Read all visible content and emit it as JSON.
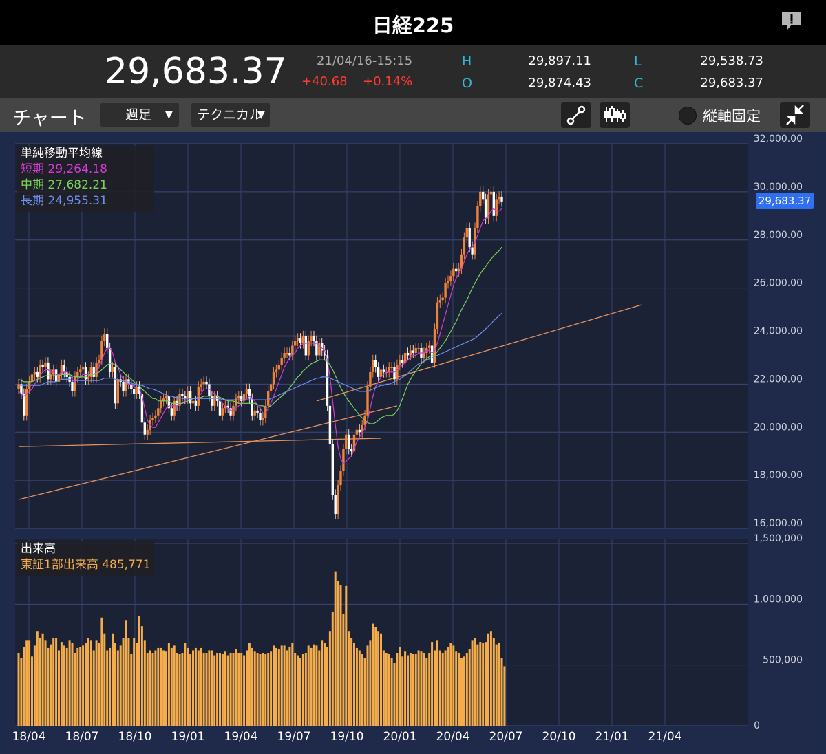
{
  "app": {
    "title": "日経225"
  },
  "quote": {
    "price": "29,683.37",
    "timestamp": "21/04/16-15:15",
    "change": "+40.68",
    "change_pct": "+0.14%",
    "h_label": "H",
    "h_value": "29,897.11",
    "o_label": "O",
    "o_value": "29,874.43",
    "l_label": "L",
    "l_value": "29,538.73",
    "c_label": "C",
    "c_value": "29,683.37"
  },
  "toolbar": {
    "title": "チャート",
    "period": "週足",
    "technical": "テクニカル",
    "lock_label": "縦軸固定"
  },
  "colors": {
    "up": "#f0823a",
    "down": "#ffffff",
    "short_ma": "#d23cd2",
    "mid_ma": "#7bd45a",
    "long_ma": "#6f8ff0",
    "volume": "#f4ad4a",
    "accent": "#2f6ff0"
  },
  "icons": [
    "alert-icon",
    "trendline-icon",
    "candle-tool-icon",
    "collapse-icon"
  ],
  "ma_legend": {
    "title": "単純移動平均線",
    "short_label": "短期",
    "short_value": "29,264.18",
    "mid_label": "中期",
    "mid_value": "27,682.21",
    "long_label": "長期",
    "long_value": "24,955.31"
  },
  "vol_legend": {
    "title": "出来高",
    "label": "東証1部出来高",
    "value": "485,771"
  },
  "price_tag": "29,683.37",
  "chart_data": {
    "type": "candlestick",
    "x_tick_labels": [
      "18/04",
      "18/07",
      "18/10",
      "19/01",
      "19/04",
      "19/07",
      "19/10",
      "20/01",
      "20/04",
      "20/07",
      "20/10",
      "21/01",
      "21/04"
    ],
    "y_tick_labels": [
      "16,000.00",
      "18,000.00",
      "20,000.00",
      "22,000.00",
      "24,000.00",
      "26,000.00",
      "28,000.00",
      "30,000.00",
      "32,000.00"
    ],
    "ylim": [
      16000,
      32000
    ],
    "vol_tick_labels": [
      "0",
      "500,000",
      "1,000,000",
      "1,500,000"
    ],
    "vol_ylim": [
      0,
      1500000
    ],
    "closes": [
      22000,
      21600,
      20700,
      21800,
      22100,
      22400,
      22500,
      22300,
      22800,
      22700,
      22900,
      22200,
      22400,
      22600,
      22100,
      22400,
      22800,
      22500,
      22300,
      22100,
      21700,
      22300,
      22500,
      22600,
      22700,
      22200,
      22300,
      22700,
      22300,
      22900,
      23000,
      23800,
      24100,
      23500,
      22500,
      22700,
      21200,
      22200,
      22100,
      21700,
      22200,
      22000,
      21800,
      21600,
      21900,
      21600,
      20400,
      19900,
      20100,
      20500,
      20600,
      20700,
      21000,
      21300,
      21400,
      21500,
      21000,
      20700,
      21300,
      21100,
      21600,
      21500,
      21400,
      21700,
      21200,
      21300,
      21100,
      21900,
      22000,
      22100,
      22000,
      21500,
      21100,
      21500,
      21300,
      20700,
      21000,
      21100,
      21000,
      20700,
      21100,
      21400,
      21500,
      21300,
      21600,
      21800,
      21400,
      20700,
      20900,
      20800,
      20500,
      20600,
      21100,
      21700,
      22000,
      22500,
      22600,
      22800,
      23100,
      23300,
      23300,
      23200,
      23600,
      23800,
      23900,
      23700,
      24000,
      23200,
      23800,
      24000,
      23800,
      23200,
      23700,
      23400,
      23200,
      21100,
      19500,
      17400,
      16600,
      17800,
      18400,
      19300,
      19900,
      19300,
      19200,
      19900,
      20100,
      20000,
      20300,
      20700,
      21900,
      22500,
      23000,
      22700,
      22300,
      22600,
      22500,
      22500,
      22700,
      22700,
      22200,
      22800,
      23000,
      22900,
      23300,
      23200,
      23400,
      23300,
      23500,
      23500,
      23100,
      23300,
      23500,
      23600,
      22900,
      24300,
      25400,
      25500,
      25600,
      26200,
      26300,
      26500,
      26800,
      26700,
      26800,
      27400,
      28100,
      28500,
      27700,
      27400,
      28500,
      29400,
      30000,
      29700,
      28900,
      29900,
      30000,
      29000,
      29700,
      29800,
      29600
    ],
    "volumes": [
      600000,
      560000,
      650000,
      700000,
      700000,
      570000,
      660000,
      780000,
      720000,
      760000,
      700000,
      640000,
      670000,
      720000,
      720000,
      620000,
      690000,
      660000,
      640000,
      700000,
      680000,
      600000,
      640000,
      650000,
      660000,
      680000,
      720000,
      700000,
      620000,
      700000,
      680000,
      890000,
      760000,
      620000,
      640000,
      760000,
      680000,
      620000,
      660000,
      720000,
      870000,
      720000,
      590000,
      720000,
      680000,
      900000,
      820000,
      700000,
      600000,
      620000,
      600000,
      620000,
      640000,
      640000,
      620000,
      610000,
      680000,
      640000,
      660000,
      600000,
      590000,
      600000,
      680000,
      640000,
      590000,
      620000,
      640000,
      620000,
      640000,
      600000,
      600000,
      620000,
      620000,
      580000,
      600000,
      600000,
      590000,
      610000,
      580000,
      600000,
      600000,
      630000,
      600000,
      600000,
      580000,
      620000,
      680000,
      640000,
      610000,
      600000,
      590000,
      600000,
      590000,
      600000,
      610000,
      660000,
      640000,
      630000,
      660000,
      660000,
      620000,
      650000,
      680000,
      600000,
      580000,
      560000,
      590000,
      600000,
      660000,
      640000,
      670000,
      660000,
      620000,
      700000,
      680000,
      650000,
      780000,
      940000,
      1270000,
      1190000,
      1160000,
      920000,
      1150000,
      780000,
      720000,
      680000,
      640000,
      620000,
      590000,
      560000,
      660000,
      700000,
      840000,
      810000,
      780000,
      760000,
      620000,
      600000,
      590000,
      560000,
      520000,
      600000,
      650000,
      570000,
      610000,
      580000,
      600000,
      590000,
      590000,
      620000,
      610000,
      600000,
      560000,
      600000,
      690000,
      620000,
      700000,
      620000,
      600000,
      620000,
      650000,
      680000,
      660000,
      610000,
      600000,
      560000,
      570000,
      600000,
      630000,
      700000,
      720000,
      670000,
      690000,
      680000,
      690000,
      760000,
      780000,
      720000,
      670000,
      680000,
      560000,
      490000
    ],
    "series": [
      {
        "name": "短期",
        "values": [
          21700,
          21600,
          21500,
          21600,
          21700,
          21800,
          22000,
          22200,
          22400,
          22500,
          22600,
          22600,
          22500,
          22500,
          22400,
          22400,
          22500,
          22500,
          22500,
          22400,
          22200,
          22100,
          22200,
          22300,
          22400,
          22400,
          22400,
          22400,
          22400,
          22500,
          22700,
          23000,
          23300,
          23500,
          23500,
          23300,
          22900,
          22700,
          22400,
          22200,
          22100,
          22000,
          22000,
          21900,
          21800,
          21800,
          21500,
          21000,
          20500,
          20300,
          20200,
          20200,
          20400,
          20600,
          20800,
          21000,
          21100,
          21100,
          21100,
          21100,
          21200,
          21200,
          21300,
          21400,
          21400,
          21400,
          21400,
          21500,
          21600,
          21800,
          21800,
          21800,
          21700,
          21600,
          21500,
          21300,
          21200,
          21100,
          21000,
          20900,
          20900,
          21000,
          21100,
          21200,
          21300,
          21400,
          21500,
          21400,
          21300,
          21100,
          21000,
          20800,
          20800,
          21000,
          21200,
          21500,
          21800,
          22100,
          22400,
          22700,
          22900,
          23100,
          23200,
          23300,
          23500,
          23600,
          23700,
          23700,
          23700,
          23700,
          23700,
          23700,
          23600,
          23500,
          23400,
          23000,
          22300,
          21300,
          20300,
          19400,
          18900,
          18700,
          18800,
          18900,
          19000,
          19300,
          19600,
          19800,
          20000,
          20200,
          20500,
          21000,
          21500,
          21900,
          22100,
          22300,
          22400,
          22500,
          22500,
          22500,
          22500,
          22600,
          22700,
          22800,
          22900,
          23000,
          23100,
          23200,
          23200,
          23300,
          23300,
          23300,
          23400,
          23400,
          23300,
          23400,
          23700,
          24100,
          24500,
          24900,
          25300,
          25700,
          26100,
          26400,
          26600,
          26800,
          27100,
          27400,
          27600,
          27700,
          27900,
          28200,
          28500,
          28800,
          28900,
          29000,
          29200,
          29300,
          29200,
          29200,
          29300
        ]
      },
      {
        "name": "中期",
        "values": [
          22200,
          22150,
          22100,
          22100,
          22100,
          22100,
          22150,
          22200,
          22250,
          22300,
          22350,
          22350,
          22350,
          22350,
          22350,
          22350,
          22400,
          22400,
          22400,
          22400,
          22350,
          22300,
          22300,
          22300,
          22300,
          22300,
          22350,
          22400,
          22400,
          22450,
          22500,
          22600,
          22700,
          22800,
          22850,
          22850,
          22800,
          22700,
          22600,
          22500,
          22400,
          22300,
          22200,
          22100,
          22000,
          21900,
          21800,
          21700,
          21600,
          21500,
          21400,
          21400,
          21300,
          21300,
          21300,
          21300,
          21300,
          21200,
          21200,
          21200,
          21200,
          21200,
          21250,
          21300,
          21350,
          21400,
          21400,
          21400,
          21450,
          21500,
          21500,
          21500,
          21500,
          21500,
          21500,
          21450,
          21400,
          21350,
          21300,
          21300,
          21300,
          21250,
          21200,
          21200,
          21200,
          21200,
          21200,
          21200,
          21200,
          21150,
          21100,
          21100,
          21050,
          21050,
          21100,
          21200,
          21300,
          21400,
          21500,
          21600,
          21700,
          21850,
          22000,
          22150,
          22300,
          22400,
          22550,
          22650,
          22750,
          22850,
          22900,
          22950,
          23000,
          23000,
          23000,
          22950,
          22800,
          22600,
          22350,
          22100,
          21850,
          21650,
          21450,
          21300,
          21150,
          21000,
          20850,
          20700,
          20600,
          20500,
          20400,
          20350,
          20350,
          20400,
          20500,
          20600,
          20650,
          20700,
          20700,
          20700,
          20750,
          20900,
          21100,
          21400,
          21700,
          22000,
          22200,
          22400,
          22550,
          22700,
          22850,
          22950,
          23050,
          23150,
          23200,
          23250,
          23350,
          23500,
          23650,
          23800,
          24000,
          24200,
          24400,
          24600,
          24850,
          25100,
          25300,
          25500,
          25750,
          26000,
          26200,
          26400,
          26600,
          26750,
          26900,
          27050,
          27200,
          27350,
          27450,
          27550,
          27700
        ]
      },
      {
        "name": "長期",
        "values": [
          21950,
          21950,
          21950,
          21950,
          21950,
          21950,
          21950,
          21950,
          21950,
          22000,
          22050,
          22100,
          22100,
          22100,
          22100,
          22150,
          22200,
          22200,
          22200,
          22200,
          22150,
          22150,
          22150,
          22150,
          22150,
          22150,
          22150,
          22150,
          22150,
          22150,
          22150,
          22200,
          22250,
          22250,
          22250,
          22250,
          22200,
          22200,
          22150,
          22150,
          22100,
          22100,
          22050,
          22000,
          22000,
          21950,
          21950,
          21900,
          21850,
          21800,
          21800,
          21750,
          21700,
          21650,
          21600,
          21550,
          21500,
          21500,
          21450,
          21450,
          21450,
          21400,
          21400,
          21400,
          21400,
          21400,
          21400,
          21400,
          21400,
          21400,
          21400,
          21400,
          21400,
          21400,
          21400,
          21400,
          21350,
          21350,
          21350,
          21350,
          21350,
          21350,
          21350,
          21350,
          21350,
          21350,
          21350,
          21350,
          21350,
          21350,
          21350,
          21350,
          21350,
          21350,
          21400,
          21450,
          21500,
          21550,
          21600,
          21650,
          21700,
          21750,
          21800,
          21850,
          21900,
          21950,
          22000,
          22050,
          22100,
          22150,
          22200,
          22250,
          22250,
          22300,
          22300,
          22300,
          22250,
          22200,
          22150,
          22100,
          22050,
          22000,
          21950,
          21900,
          21850,
          21800,
          21750,
          21700,
          21700,
          21700,
          21700,
          21750,
          21800,
          21850,
          21900,
          21950,
          21950,
          22000,
          22000,
          22050,
          22100,
          22150,
          22200,
          22300,
          22350,
          22450,
          22550,
          22650,
          22750,
          22850,
          22900,
          22950,
          23000,
          23050,
          23100,
          23150,
          23200,
          23250,
          23300,
          23350,
          23400,
          23450,
          23500,
          23550,
          23600,
          23650,
          23700,
          23750,
          23800,
          23850,
          23900,
          24000,
          24100,
          24200,
          24300,
          24400,
          24500,
          24650,
          24750,
          24850,
          24950
        ]
      }
    ],
    "trend_lines": [
      {
        "x1": 0,
        "y1": 24000,
        "x2": 171,
        "y2": 24000
      },
      {
        "x1": 0,
        "y1": 17200,
        "x2": 141,
        "y2": 21100
      },
      {
        "x1": 0,
        "y1": 19400,
        "x2": 135,
        "y2": 19750
      },
      {
        "x1": 111,
        "y1": 21300,
        "x2": 232,
        "y2": 25300
      }
    ]
  }
}
